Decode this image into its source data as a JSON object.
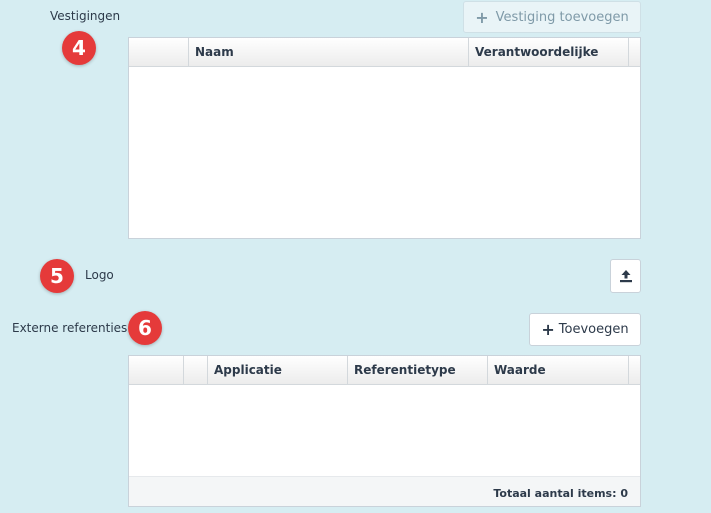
{
  "sections": {
    "vestigingen": {
      "label": "Vestigingen",
      "badge": "4",
      "add_button": "Vestiging toevoegen",
      "columns": [
        "",
        "Naam",
        "Verantwoordelijke",
        ""
      ]
    },
    "logo": {
      "label": "Logo",
      "badge": "5",
      "upload_icon": "upload-icon"
    },
    "externe_referenties": {
      "label": "Externe referenties",
      "badge": "6",
      "add_button": "Toevoegen",
      "columns": [
        "",
        "",
        "Applicatie",
        "Referentietype",
        "Waarde",
        ""
      ],
      "footer": "Totaal aantal items: 0"
    }
  },
  "colors": {
    "background": "#d6edf2",
    "badge": "#e53a3a",
    "text": "#2d3a4a"
  }
}
